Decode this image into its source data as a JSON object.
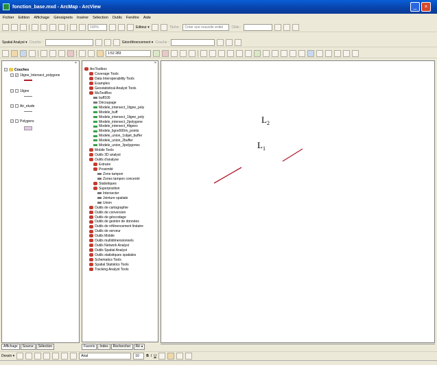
{
  "window": {
    "title": "fonction_base.mxd - ArcMap - ArcView"
  },
  "menu": [
    "Fichier",
    "Edition",
    "Affichage",
    "Géosignets",
    "Insérer",
    "Sélection",
    "Outils",
    "Fenêtre",
    "Aide"
  ],
  "editor_toolbar": {
    "scale": "100%",
    "editor_label": "Editeur ▾",
    "task_label": "Tâche :",
    "task_value": "Créer une nouvelle entité",
    "target_label": "Cible :"
  },
  "analysis_toolbar": {
    "spatial_analyst": "Spatial Analyst ▾",
    "layer_label": "Couche :",
    "georef": "Géoréférencement ▾",
    "georef_layer": "Couche :"
  },
  "standard_toolbar": {
    "scale_value": "1:52 283"
  },
  "toc": {
    "root": "Couches",
    "layers": [
      {
        "name": "1ligne_Intersect_polygone",
        "checked": true
      },
      {
        "name": "1ligne",
        "checked": false
      },
      {
        "name": "Air_etude",
        "checked": false
      },
      {
        "name": "Polygons",
        "checked": false
      }
    ]
  },
  "toc_tabs": [
    "Affichage",
    "Source",
    "Sélection"
  ],
  "toolbox": {
    "root": "ArcToolbox",
    "items": [
      "Coverage Tools",
      "Data Interoperability Tools",
      "Examples",
      "Geostatistical Analyst Tools",
      "MaToolBox",
      "buff100",
      "Découpage",
      "Modele_intersect_1ligne_poly",
      "Modele_buff",
      "Modele_intersect_1ligne_poly",
      "Modele_intersect_2polygone",
      "Modele_intersect_4lignes",
      "Modele_ligne500m_points",
      "Modele_union_1objet_buffer",
      "Modele_union_2buffer",
      "Modele_union_3polygones",
      "Mobile Tools",
      "Outils 3D analyst",
      "Outils d'analyse",
      "Extraire",
      "Proximité",
      "Zone tampon",
      "Zones tampon concentri",
      "Statistiques",
      "Superposition",
      "Intersecter",
      "Jointure spatiale",
      "Union",
      "Outils de cartographie",
      "Outils de conversion",
      "Outils de géocodage",
      "Outils de gestion de données",
      "Outils de référencement linéaire",
      "Outils de serveur",
      "Outils Mobile",
      "Outils multidimensionnels",
      "Outils Network Analyst",
      "Outils Spatial Analyst",
      "Outils statistiques spatiales",
      "Schematics Tools",
      "Spatial Statistics Tools",
      "Tracking Analyst Tools"
    ]
  },
  "toolbox_tabs": [
    "Favoris",
    "Index",
    "Rechercher",
    "Ré ◂"
  ],
  "map": {
    "label1": "L",
    "sub1": "1",
    "label2": "L",
    "sub2": "2",
    "line_color": "#b0192a"
  },
  "drawing": {
    "dessin": "Dessin ▾",
    "font": "Arial",
    "size": "10"
  }
}
